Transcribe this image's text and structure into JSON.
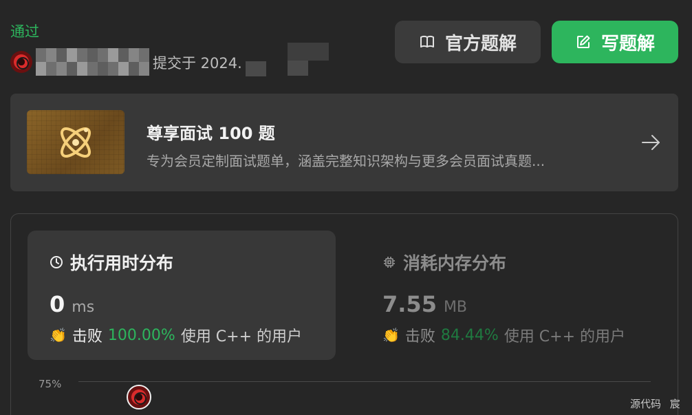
{
  "header": {
    "status": "通过",
    "submitted": "提交于 2024.",
    "official_solution_label": "官方题解",
    "write_solution_label": "写题解"
  },
  "promo": {
    "title": "尊享面试 100 题",
    "description": "专为会员定制面试题单，涵盖完整知识架构与更多会员面试真题...",
    "icon": "atom-icon"
  },
  "runtime": {
    "title": "执行用时分布",
    "value": "0",
    "unit": "ms",
    "beat_label": "击败",
    "percent": "100.00%",
    "suffix": "使用 C++ 的用户",
    "icon": "clock-icon"
  },
  "memory": {
    "title": "消耗内存分布",
    "value": "7.55",
    "unit": "MB",
    "beat_label": "击败",
    "percent": "84.44%",
    "suffix": "使用 C++ 的用户",
    "icon": "chip-icon"
  },
  "chart": {
    "y_label": "75%"
  },
  "footer": {
    "text": "源代码 宸"
  },
  "colors": {
    "accent": "#2db55d",
    "background": "#262626",
    "card": "#383838"
  }
}
